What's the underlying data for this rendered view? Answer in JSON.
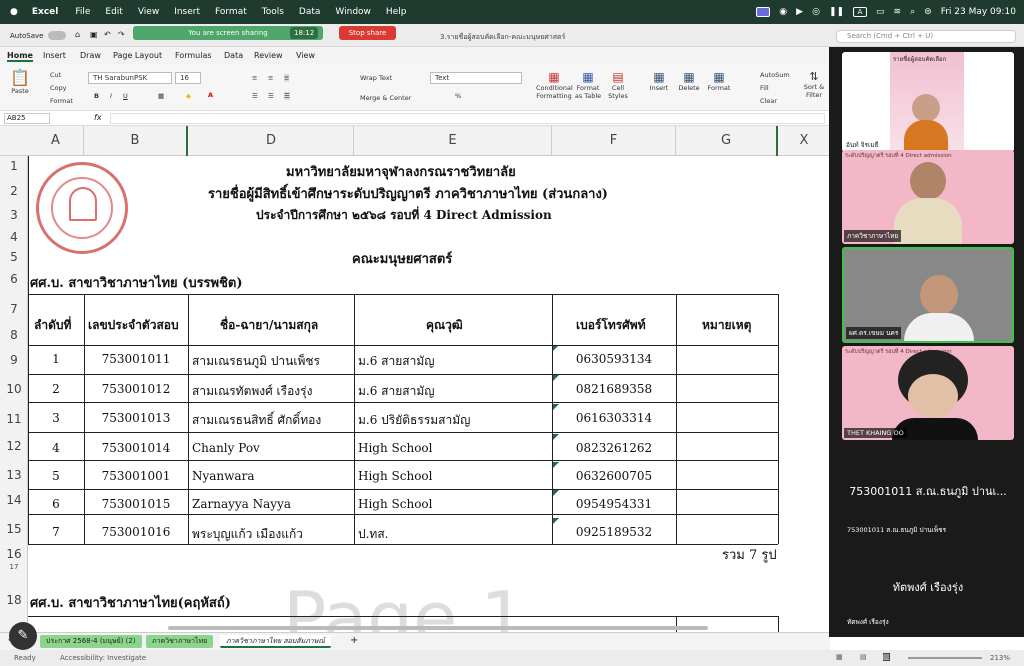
{
  "menubar": {
    "app": "Excel",
    "items": [
      "File",
      "Edit",
      "View",
      "Insert",
      "Format",
      "Tools",
      "Data",
      "Window",
      "Help"
    ],
    "clock": "Fri 23 May  09:10"
  },
  "titlebar": {
    "autosave": "AutoSave",
    "sharing": "You are screen sharing",
    "timer": "18:12",
    "stop": "Stop share",
    "filename": "3.รายชื่อผู้สอบคัดเลือก-คณะมนุษยศาสตร์",
    "search": "Search (Cmd + Ctrl + U)"
  },
  "tabs": [
    "Home",
    "Insert",
    "Draw",
    "Page Layout",
    "Formulas",
    "Data",
    "Review",
    "View"
  ],
  "ribbon": {
    "font": "TH SarabunPSK",
    "size": "16",
    "wrap": "Wrap Text",
    "format": "Text",
    "merge": "Merge & Center",
    "paste": "Paste",
    "cut": "Cut",
    "copy": "Copy",
    "fmt": "Format",
    "cond": "Conditional Formatting",
    "fat": "Format as Table",
    "cs": "Cell Styles",
    "ins": "Insert",
    "del": "Delete",
    "fmt2": "Format",
    "autosum": "AutoSum",
    "fill": "Fill",
    "clear": "Clear",
    "sort": "Sort & Filter"
  },
  "formula": {
    "cell": "AB25",
    "fx": "fx"
  },
  "columns": [
    "A",
    "B",
    "D",
    "E",
    "F",
    "G",
    "X"
  ],
  "rows": [
    "1",
    "2",
    "3",
    "4",
    "5",
    "6",
    "7",
    "8",
    "9",
    "10",
    "11",
    "12",
    "13",
    "14",
    "15",
    "16",
    "17",
    "18"
  ],
  "sheet": {
    "h1": "มหาวิทยาลัยมหาจุฬาลงกรณราชวิทยาลัย",
    "h2": "รายชื่อผู้มีสิทธิ์เข้าศึกษาระดับปริญญาตรี ภาควิชาภาษาไทย (ส่วนกลาง)",
    "h3": "ประจำปีการศึกษา  ๒๕๖๘ รอบที่ 4 Direct Admission",
    "faculty": "คณะมนุษยศาสตร์",
    "sec1": "ศศ.บ. สาขาวิชาภาษาไทย (บรรพชิต)",
    "heads": [
      "ลำดับที่",
      "เลขประจำตัวสอบ",
      "ชื่อ-ฉายา/นามสกุล",
      "คุณวุฒิ",
      "เบอร์โทรศัพท์",
      "หมายเหตุ"
    ],
    "rows": [
      [
        "1",
        "753001011",
        "สามเณรธนภูมิ  ปานเพ็ชร",
        "ม.6 สายสามัญ",
        "0630593134"
      ],
      [
        "2",
        "753001012",
        "สามเณรทัตพงศ์  เรืองรุ่ง",
        "ม.6 สายสามัญ",
        "0821689358"
      ],
      [
        "3",
        "753001013",
        "สามเณรธนสิทธิ์  ศักดิ์ทอง",
        "ม.6 ปริยัติธรรมสามัญ",
        "0616303314"
      ],
      [
        "4",
        "753001014",
        "Chanly Pov",
        "High School",
        "0823261262"
      ],
      [
        "5",
        "753001001",
        "Nyanwara",
        "High School",
        "0632600705"
      ],
      [
        "6",
        "753001015",
        "Zarnayya Nayya",
        "High School",
        "0954954331"
      ],
      [
        "7",
        "753001016",
        "พระบุญแก้ว  เมืองแก้ว",
        "ป.ทส.",
        "0925189532"
      ]
    ],
    "total": "รวม 7 รูป",
    "sec2": "ศศ.บ. สาขาวิชาภาษาไทย(คฤหัสถ์)",
    "watermark": "Page 1"
  },
  "sheettabs": [
    "ประกาศ 2568-4 (มนุษย์) (2)",
    "ภาควิชาภาษาไทย",
    "ภาควิชาภาษาไทย สอบสัมภาษณ์"
  ],
  "status": {
    "ready": "Ready",
    "access": "Accessibility: Investigate",
    "zoom": "213%"
  },
  "participants": [
    {
      "name": "อันท์ จิรเมธี",
      "banner": "รายชื่อผู้สอบคัดเลือก"
    },
    {
      "name": "ภาควิชาภาษาไทย",
      "banner": "ระดับปริญญาตรี รอบที่ 4 Direct admission"
    },
    {
      "name": "ผศ.ดร.เขษม นคร"
    },
    {
      "name": "THET KHAING OO",
      "banner": "ระดับปริญญาตรี รอบที่ 4 Direct admission"
    },
    {
      "name": "753001011 ส.ณ.ธนภูมิ ปานเพ็ชร",
      "big": "753001011 ส.ณ.ธนภูมิ ปานเ..."
    },
    {
      "name": "ทัตพงศ์ เรืองรุ่ง",
      "big": "ทัตพงศ์ เรืองรุ่ง"
    }
  ]
}
